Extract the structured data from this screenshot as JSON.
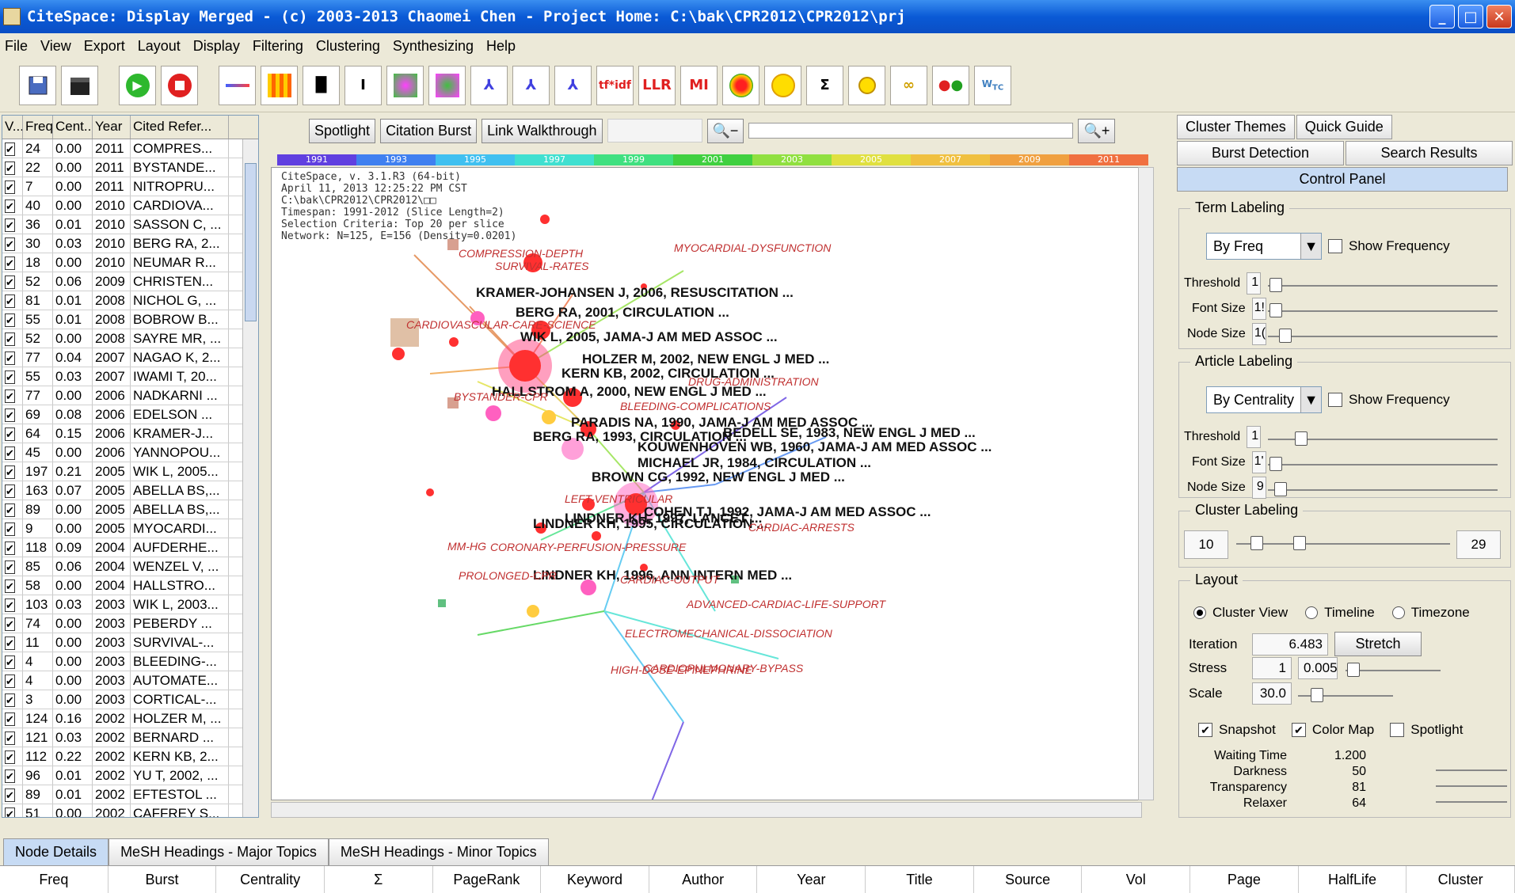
{
  "window": {
    "title": "CiteSpace: Display Merged - (c) 2003-2013 Chaomei Chen - Project Home: C:\\bak\\CPR2012\\CPR2012\\prj"
  },
  "menu": [
    "File",
    "View",
    "Export",
    "Layout",
    "Display",
    "Filtering",
    "Clustering",
    "Synthesizing",
    "Help"
  ],
  "toolbar": {
    "tfidf": "tf*idf",
    "llr": "LLR",
    "mi": "MI",
    "sigma": "Σ"
  },
  "table": {
    "columns": [
      "V...",
      "Freq",
      "Cent...",
      "Year",
      "Cited Refer..."
    ],
    "rows": [
      [
        "24",
        "0.00",
        "2011",
        "COMPRES..."
      ],
      [
        "22",
        "0.00",
        "2011",
        "BYSTANDE..."
      ],
      [
        "7",
        "0.00",
        "2011",
        "NITROPRU..."
      ],
      [
        "40",
        "0.00",
        "2010",
        "CARDIOVA..."
      ],
      [
        "36",
        "0.01",
        "2010",
        "SASSON C, ..."
      ],
      [
        "30",
        "0.03",
        "2010",
        "BERG RA, 2..."
      ],
      [
        "18",
        "0.00",
        "2010",
        "NEUMAR R..."
      ],
      [
        "52",
        "0.06",
        "2009",
        "CHRISTEN..."
      ],
      [
        "81",
        "0.01",
        "2008",
        "NICHOL G, ..."
      ],
      [
        "55",
        "0.01",
        "2008",
        "BOBROW B..."
      ],
      [
        "52",
        "0.00",
        "2008",
        "SAYRE MR, ..."
      ],
      [
        "77",
        "0.04",
        "2007",
        "NAGAO K, 2..."
      ],
      [
        "55",
        "0.03",
        "2007",
        "IWAMI T, 20..."
      ],
      [
        "77",
        "0.00",
        "2006",
        "NADKARNI ..."
      ],
      [
        "69",
        "0.08",
        "2006",
        "EDELSON ..."
      ],
      [
        "64",
        "0.15",
        "2006",
        "KRAMER-J..."
      ],
      [
        "45",
        "0.00",
        "2006",
        "YANNOPOU..."
      ],
      [
        "197",
        "0.21",
        "2005",
        "WIK L, 2005..."
      ],
      [
        "163",
        "0.07",
        "2005",
        "ABELLA BS,..."
      ],
      [
        "89",
        "0.00",
        "2005",
        "ABELLA BS,..."
      ],
      [
        "9",
        "0.00",
        "2005",
        "MYOCARDI..."
      ],
      [
        "118",
        "0.09",
        "2004",
        "AUFDERHE..."
      ],
      [
        "85",
        "0.06",
        "2004",
        "WENZEL V, ..."
      ],
      [
        "58",
        "0.00",
        "2004",
        "HALLSTRO..."
      ],
      [
        "103",
        "0.03",
        "2003",
        "WIK L, 2003..."
      ],
      [
        "74",
        "0.00",
        "2003",
        "PEBERDY ..."
      ],
      [
        "11",
        "0.00",
        "2003",
        "SURVIVAL-..."
      ],
      [
        "4",
        "0.00",
        "2003",
        "BLEEDING-..."
      ],
      [
        "4",
        "0.00",
        "2003",
        "AUTOMATE..."
      ],
      [
        "3",
        "0.00",
        "2003",
        "CORTICAL-..."
      ],
      [
        "124",
        "0.16",
        "2002",
        "HOLZER M, ..."
      ],
      [
        "121",
        "0.03",
        "2002",
        "BERNARD ..."
      ],
      [
        "112",
        "0.22",
        "2002",
        "KERN KB, 2..."
      ],
      [
        "96",
        "0.01",
        "2002",
        "YU T, 2002, ..."
      ],
      [
        "89",
        "0.01",
        "2002",
        "EFTESTOL ..."
      ],
      [
        "51",
        "0.00",
        "2002",
        "CAFFREY S..."
      ]
    ]
  },
  "center": {
    "buttons": {
      "spotlight": "Spotlight",
      "burst": "Citation Burst",
      "walk": "Link Walkthrough"
    },
    "years": [
      "1991",
      "1993",
      "1995",
      "1997",
      "1999",
      "2001",
      "2003",
      "2005",
      "2007",
      "2009",
      "2011"
    ],
    "info": "CiteSpace, v. 3.1.R3 (64-bit)\nApril 11, 2013 12:25:22 PM CST\nC:\\bak\\CPR2012\\CPR2012\\□□\nTimespan: 1991-2012 (Slice Length=2)\nSelection Criteria: Top 20 per slice\nNetwork: N=125, E=156 (Density=0.0201)",
    "node_labels": [
      "KRAMER-JOHANSEN J, 2006, RESUSCITATION ...",
      "BERG RA, 2001, CIRCULATION ...",
      "WIK L, 2005, JAMA-J AM MED ASSOC ...",
      "HOLZER M, 2002, NEW ENGL J MED ...",
      "KERN KB, 2002, CIRCULATION ...",
      "HALLSTROM A, 2000, NEW ENGL J MED ...",
      "PARADIS NA, 1990, JAMA-J AM MED ASSOC ...",
      "BEDELL SE, 1983, NEW ENGL J MED ...",
      "BERG RA, 1993, CIRCULATION ...",
      "KOUWENHOVEN WB, 1960, JAMA-J AM MED ASSOC ...",
      "MICHAEL JR, 1984, CIRCULATION ...",
      "BROWN CG, 1992, NEW ENGL J MED ...",
      "COHEN TJ, 1992, JAMA-J AM MED ASSOC ...",
      "LINDNER KH, 1995, CIRCULATION ...",
      "LINDNER KH, 1997, LANCET ...",
      "LINDNER KH, 1996, ANN INTERN MED ..."
    ],
    "keyword_labels": [
      "COMPRESSION-DEPTH",
      "SURVIVAL-RATES",
      "MYOCARDIAL-DYSFUNCTION",
      "CARDIOVASCULAR-CARE-SCIENCE",
      "DRUG-ADMINISTRATION",
      "BYSTANDER-CPR",
      "BLEEDING-COMPLICATIONS",
      "LEFT-VENTRICULAR",
      "CARDIAC-ARRESTS",
      "MM-HG",
      "CORONARY-PERFUSION-PRESSURE",
      "PROLONGED-CPR",
      "CARDIAC-OUTPUT",
      "ADVANCED-CARDIAC-LIFE-SUPPORT",
      "ELECTROMECHANICAL-DISSOCIATION",
      "HIGH-DOSE-EPINEPHRINE",
      "CARDIOPULMONARY-BYPASS"
    ]
  },
  "right": {
    "tabs1": [
      "Cluster Themes",
      "Quick Guide"
    ],
    "tabs2": [
      "Burst Detection",
      "Search Results"
    ],
    "control": "Control Panel",
    "term": {
      "title": "Term Labeling",
      "mode": "By Freq",
      "showfreq": "Show Frequency",
      "threshold": "Threshold",
      "threshold_val": "1",
      "font": "Font Size",
      "font_val": "1!",
      "node": "Node Size",
      "node_val": "1("
    },
    "article": {
      "title": "Article Labeling",
      "mode": "By Centrality",
      "showfreq": "Show Frequency",
      "threshold": "Threshold",
      "threshold_val": "1",
      "font": "Font Size",
      "font_val": "1'",
      "node": "Node Size",
      "node_val": "9"
    },
    "cluster": {
      "title": "Cluster Labeling",
      "min": "10",
      "max": "29"
    },
    "layout": {
      "title": "Layout",
      "cluster_view": "Cluster View",
      "timeline": "Timeline",
      "timezone": "Timezone",
      "iteration": "Iteration",
      "iteration_val": "6.483",
      "stretch": "Stretch",
      "stress": "Stress",
      "stress_val": "1",
      "stress_val2": "0.005",
      "scale": "Scale",
      "scale_val": "30.0"
    },
    "display": {
      "snapshot": "Snapshot",
      "colormap": "Color Map",
      "spotlight": "Spotlight",
      "waiting": "Waiting Time",
      "waiting_val": "1.200",
      "darkness": "Darkness",
      "darkness_val": "50",
      "transparency": "Transparency",
      "transparency_val": "81",
      "relaxer": "Relaxer",
      "relaxer_val": "64"
    }
  },
  "bottom": {
    "tabs": [
      "Node Details",
      "MeSH Headings - Major Topics",
      "MeSH Headings - Minor Topics"
    ],
    "columns": [
      "Freq",
      "Burst",
      "Centrality",
      "Σ",
      "PageRank",
      "Keyword",
      "Author",
      "Year",
      "Title",
      "Source",
      "Vol",
      "Page",
      "HalfLife",
      "Cluster"
    ]
  }
}
